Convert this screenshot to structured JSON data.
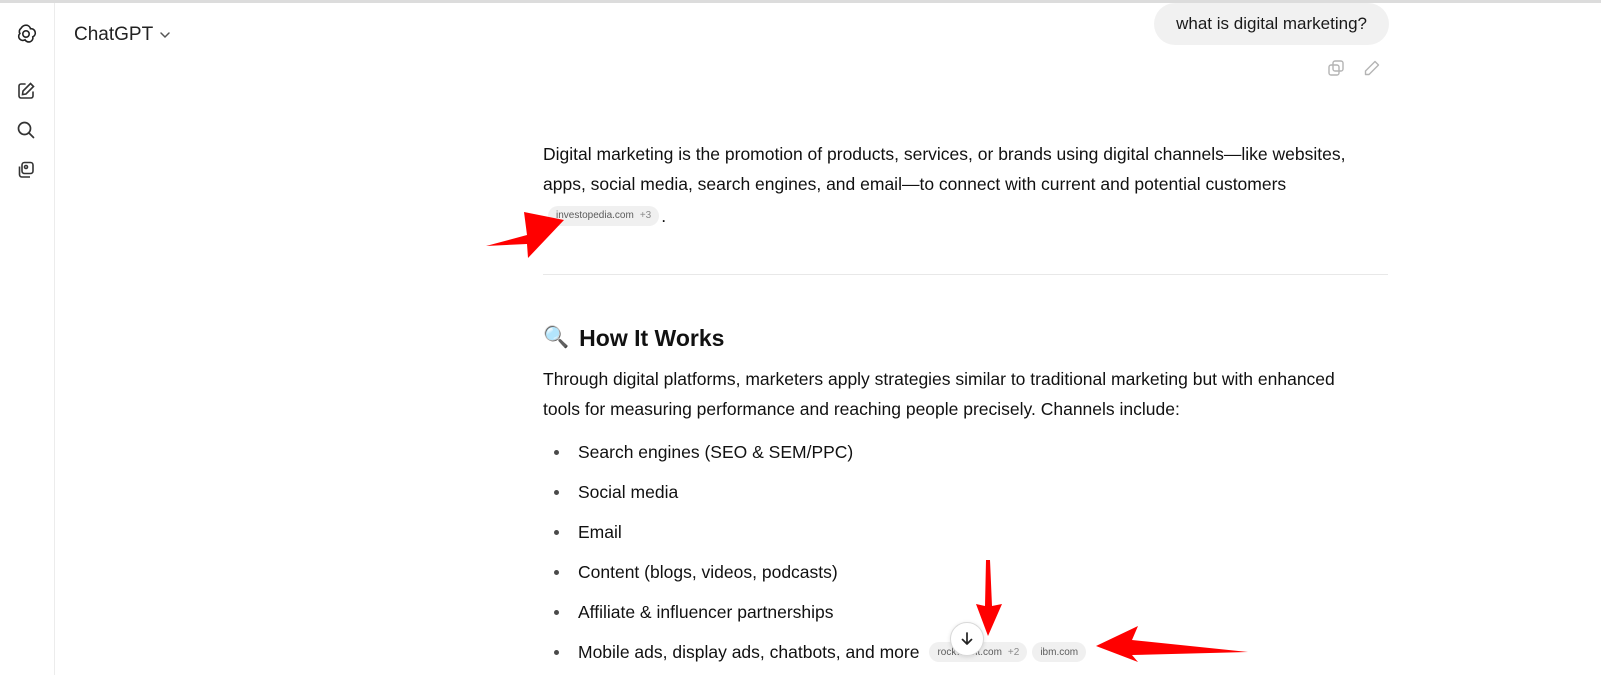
{
  "header": {
    "model_name": "ChatGPT"
  },
  "sidebar": {
    "buttons": [
      {
        "icon": "new-chat-icon"
      },
      {
        "icon": "search-icon"
      },
      {
        "icon": "library-icon"
      }
    ]
  },
  "user_message": {
    "text": "what is digital marketing?"
  },
  "response": {
    "intro": "Digital marketing is the promotion of products, services, or brands using digital channels—like websites, apps, social media, search engines, and email—to connect with current and potential customers",
    "intro_citation": {
      "source": "investopedia.com",
      "more": "+3"
    },
    "intro_end": ".",
    "section_heading": "How It Works",
    "section_emoji": "🔍",
    "section_paragraph": "Through digital platforms, marketers apply strategies similar to traditional marketing but with enhanced tools for measuring performance and reaching people precisely. Channels include:",
    "channels": [
      "Search engines (SEO & SEM/PPC)",
      "Social media",
      "Email",
      "Content (blogs, videos, podcasts)",
      "Affiliate & influencer partnerships",
      "Mobile ads, display ads, chatbots, and more"
    ],
    "last_citations": [
      {
        "source": "rock…ent.com",
        "more": "+2"
      },
      {
        "source": "ibm.com",
        "more": ""
      }
    ]
  },
  "colors": {
    "annotation_arrow": "#ff0000",
    "bubble": "#f1f1f1"
  }
}
